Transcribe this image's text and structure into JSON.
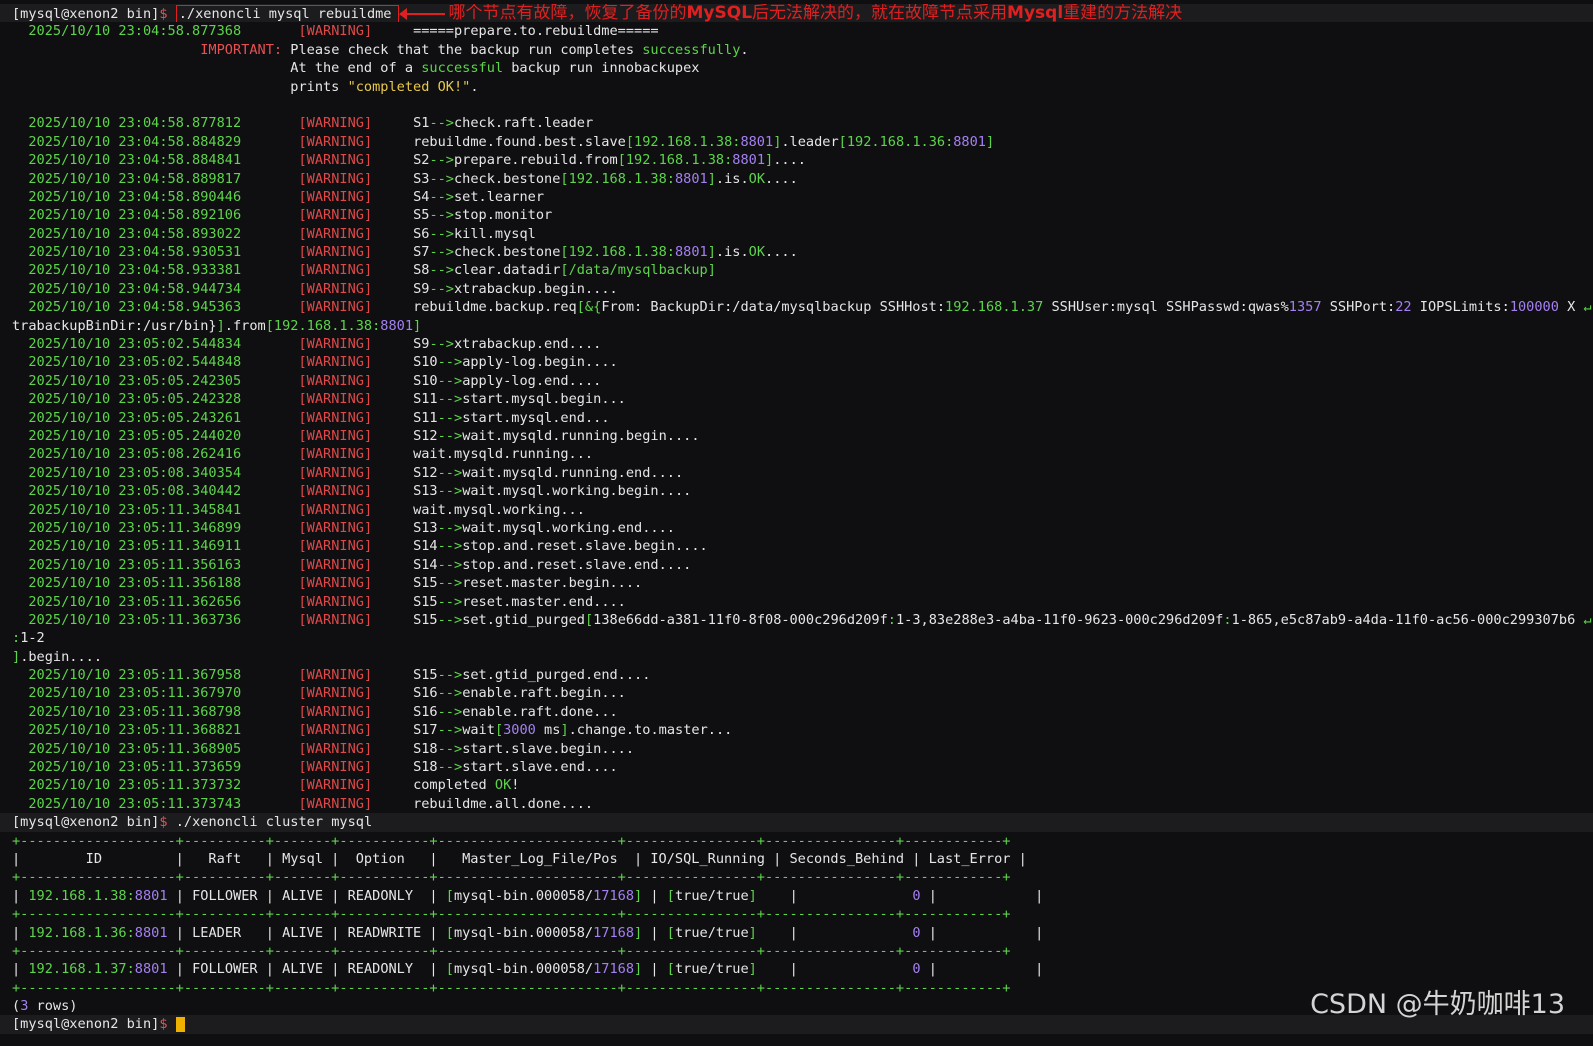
{
  "prompt": "[mysql@xenon2 bin]",
  "dollar": "$",
  "cmd1": "./xenoncli mysql rebuildme",
  "annotation": {
    "p1": "哪个节点有故障，恢复了备份的",
    "b1": "MySQL",
    "p2": "后无法解决的，就在故障节点采用",
    "b2": "Mysql",
    "p3": "重建的方法解决"
  },
  "warn_label": "[WARNING]",
  "prepare_ts": "2025/10/10 23:04:58.877368",
  "prepare_msg": "=====prepare.to.rebuildme=====",
  "important_label": "IMPORTANT:",
  "important_lines": [
    [
      "Please check that the backup run completes ",
      "successfully",
      "."
    ],
    [
      "At the end of a ",
      "successful",
      " backup run innobackupex"
    ],
    [
      "prints ",
      "\"completed OK!\"",
      "."
    ]
  ],
  "logs_a": [
    {
      "ts": "2025/10/10 23:04:58.877812",
      "p": [
        {
          "t": "S1"
        },
        {
          "t": "-->",
          "c": "sep"
        },
        {
          "t": "check.raft.leader"
        }
      ]
    },
    {
      "ts": "2025/10/10 23:04:58.884829",
      "p": [
        {
          "t": "rebuildme.found.best.slave"
        },
        {
          "t": "[192.168.1.38:",
          "c": "green"
        },
        {
          "t": "8801",
          "c": "purple"
        },
        {
          "t": "]",
          "c": "green"
        },
        {
          "t": ".leader"
        },
        {
          "t": "[192.168.1.36:",
          "c": "green"
        },
        {
          "t": "8801",
          "c": "purple"
        },
        {
          "t": "]",
          "c": "green"
        }
      ]
    },
    {
      "ts": "2025/10/10 23:04:58.884841",
      "p": [
        {
          "t": "S2"
        },
        {
          "t": "-->",
          "c": "sep"
        },
        {
          "t": "prepare.rebuild.from"
        },
        {
          "t": "[192.168.1.38:",
          "c": "green"
        },
        {
          "t": "8801",
          "c": "purple"
        },
        {
          "t": "]",
          "c": "green"
        },
        {
          "t": "...."
        }
      ]
    },
    {
      "ts": "2025/10/10 23:04:58.889817",
      "p": [
        {
          "t": "S3"
        },
        {
          "t": "-->",
          "c": "sep"
        },
        {
          "t": "check.bestone"
        },
        {
          "t": "[192.168.1.38:",
          "c": "green"
        },
        {
          "t": "8801",
          "c": "purple"
        },
        {
          "t": "]",
          "c": "green"
        },
        {
          "t": ".is."
        },
        {
          "t": "OK",
          "c": "green"
        },
        {
          "t": "...."
        }
      ]
    },
    {
      "ts": "2025/10/10 23:04:58.890446",
      "p": [
        {
          "t": "S4"
        },
        {
          "t": "-->",
          "c": "sep"
        },
        {
          "t": "set.learner"
        }
      ]
    },
    {
      "ts": "2025/10/10 23:04:58.892106",
      "p": [
        {
          "t": "S5"
        },
        {
          "t": "-->",
          "c": "sep"
        },
        {
          "t": "stop.monitor"
        }
      ]
    },
    {
      "ts": "2025/10/10 23:04:58.893022",
      "p": [
        {
          "t": "S6"
        },
        {
          "t": "-->",
          "c": "sep"
        },
        {
          "t": "kill.mysql"
        }
      ]
    },
    {
      "ts": "2025/10/10 23:04:58.930531",
      "p": [
        {
          "t": "S7"
        },
        {
          "t": "-->",
          "c": "sep"
        },
        {
          "t": "check.bestone"
        },
        {
          "t": "[192.168.1.38:",
          "c": "green"
        },
        {
          "t": "8801",
          "c": "purple"
        },
        {
          "t": "]",
          "c": "green"
        },
        {
          "t": ".is."
        },
        {
          "t": "OK",
          "c": "green"
        },
        {
          "t": "...."
        }
      ]
    },
    {
      "ts": "2025/10/10 23:04:58.933381",
      "p": [
        {
          "t": "S8"
        },
        {
          "t": "-->",
          "c": "sep"
        },
        {
          "t": "clear.datadir"
        },
        {
          "t": "[/data/mysqlbackup]",
          "c": "green"
        }
      ]
    },
    {
      "ts": "2025/10/10 23:04:58.944734",
      "p": [
        {
          "t": "S9"
        },
        {
          "t": "-->",
          "c": "sep"
        },
        {
          "t": "xtrabackup.begin...."
        }
      ]
    },
    {
      "ts": "2025/10/10 23:04:58.945363",
      "p": [
        {
          "t": "rebuildme.backup.req"
        },
        {
          "t": "[&{",
          "c": "green"
        },
        {
          "t": "From: BackupDir:/data/mysqlbackup SSHHost:"
        },
        {
          "t": "192.168.1.37",
          "c": "green"
        },
        {
          "t": " SSHUser:mysql SSHPasswd:qwas%"
        },
        {
          "t": "1357",
          "c": "purple"
        },
        {
          "t": " SSHPort:"
        },
        {
          "t": "22",
          "c": "purple"
        },
        {
          "t": " IOPSLimits:"
        },
        {
          "t": "100000",
          "c": "purple"
        },
        {
          "t": " X "
        },
        {
          "t": "↵",
          "c": "green"
        }
      ]
    }
  ],
  "wrap1": [
    {
      "t": "trabackupBinDir:/usr/bin}"
    },
    {
      "t": "]",
      "c": "green"
    },
    {
      "t": ".from"
    },
    {
      "t": "[192.168.1.38:",
      "c": "green"
    },
    {
      "t": "8801",
      "c": "purple"
    },
    {
      "t": "]",
      "c": "green"
    }
  ],
  "logs_b": [
    {
      "ts": "2025/10/10 23:05:02.544834",
      "p": [
        {
          "t": "S9"
        },
        {
          "t": "-->",
          "c": "sep"
        },
        {
          "t": "xtrabackup.end...."
        }
      ]
    },
    {
      "ts": "2025/10/10 23:05:02.544848",
      "p": [
        {
          "t": "S10"
        },
        {
          "t": "-->",
          "c": "sep"
        },
        {
          "t": "apply-log.begin...."
        }
      ]
    },
    {
      "ts": "2025/10/10 23:05:05.242305",
      "p": [
        {
          "t": "S10"
        },
        {
          "t": "-->",
          "c": "sep"
        },
        {
          "t": "apply-log.end...."
        }
      ]
    },
    {
      "ts": "2025/10/10 23:05:05.242328",
      "p": [
        {
          "t": "S11"
        },
        {
          "t": "-->",
          "c": "sep"
        },
        {
          "t": "start.mysql.begin..."
        }
      ]
    },
    {
      "ts": "2025/10/10 23:05:05.243261",
      "p": [
        {
          "t": "S11"
        },
        {
          "t": "-->",
          "c": "sep"
        },
        {
          "t": "start.mysql.end..."
        }
      ]
    },
    {
      "ts": "2025/10/10 23:05:05.244020",
      "p": [
        {
          "t": "S12"
        },
        {
          "t": "-->",
          "c": "sep"
        },
        {
          "t": "wait.mysqld.running.begin...."
        }
      ]
    },
    {
      "ts": "2025/10/10 23:05:08.262416",
      "p": [
        {
          "t": "wait.mysqld.running..."
        }
      ]
    },
    {
      "ts": "2025/10/10 23:05:08.340354",
      "p": [
        {
          "t": "S12"
        },
        {
          "t": "-->",
          "c": "sep"
        },
        {
          "t": "wait.mysqld.running.end...."
        }
      ]
    },
    {
      "ts": "2025/10/10 23:05:08.340442",
      "p": [
        {
          "t": "S13"
        },
        {
          "t": "-->",
          "c": "sep"
        },
        {
          "t": "wait.mysql.working.begin...."
        }
      ]
    },
    {
      "ts": "2025/10/10 23:05:11.345841",
      "p": [
        {
          "t": "wait.mysql.working..."
        }
      ]
    },
    {
      "ts": "2025/10/10 23:05:11.346899",
      "p": [
        {
          "t": "S13"
        },
        {
          "t": "-->",
          "c": "sep"
        },
        {
          "t": "wait.mysql.working.end...."
        }
      ]
    },
    {
      "ts": "2025/10/10 23:05:11.346911",
      "p": [
        {
          "t": "S14"
        },
        {
          "t": "-->",
          "c": "sep"
        },
        {
          "t": "stop.and.reset.slave.begin...."
        }
      ]
    },
    {
      "ts": "2025/10/10 23:05:11.356163",
      "p": [
        {
          "t": "S14"
        },
        {
          "t": "-->",
          "c": "sep"
        },
        {
          "t": "stop.and.reset.slave.end...."
        }
      ]
    },
    {
      "ts": "2025/10/10 23:05:11.356188",
      "p": [
        {
          "t": "S15"
        },
        {
          "t": "-->",
          "c": "sep"
        },
        {
          "t": "reset.master.begin...."
        }
      ]
    },
    {
      "ts": "2025/10/10 23:05:11.362656",
      "p": [
        {
          "t": "S15"
        },
        {
          "t": "-->",
          "c": "sep"
        },
        {
          "t": "reset.master.end...."
        }
      ]
    },
    {
      "ts": "2025/10/10 23:05:11.363736",
      "p": [
        {
          "t": "S15"
        },
        {
          "t": "-->",
          "c": "sep"
        },
        {
          "t": "set.gtid_purged"
        },
        {
          "t": "[",
          "c": "green"
        },
        {
          "t": "138e66dd-a381-11f0-8f08-000c296d209f"
        },
        {
          "t": ":",
          "c": "green"
        },
        {
          "t": "1-3,83e288e3-a4ba-11f0-9623-000c296d209f"
        },
        {
          "t": ":",
          "c": "green"
        },
        {
          "t": "1-865,e5c87ab9-a4da-11f0-ac56-000c299307b6 "
        },
        {
          "t": "↵",
          "c": "green"
        }
      ]
    }
  ],
  "wrap2": [
    {
      "t": ":",
      "c": "green"
    },
    {
      "t": "1-2"
    }
  ],
  "wrap3": [
    {
      "t": "]",
      "c": "green"
    },
    {
      "t": ".begin...."
    }
  ],
  "logs_c": [
    {
      "ts": "2025/10/10 23:05:11.367958",
      "p": [
        {
          "t": "S15"
        },
        {
          "t": "-->",
          "c": "sep"
        },
        {
          "t": "set.gtid_purged.end...."
        }
      ]
    },
    {
      "ts": "2025/10/10 23:05:11.367970",
      "p": [
        {
          "t": "S16"
        },
        {
          "t": "-->",
          "c": "sep"
        },
        {
          "t": "enable.raft.begin..."
        }
      ]
    },
    {
      "ts": "2025/10/10 23:05:11.368798",
      "p": [
        {
          "t": "S16"
        },
        {
          "t": "-->",
          "c": "sep"
        },
        {
          "t": "enable.raft.done..."
        }
      ]
    },
    {
      "ts": "2025/10/10 23:05:11.368821",
      "p": [
        {
          "t": "S17"
        },
        {
          "t": "-->",
          "c": "sep"
        },
        {
          "t": "wait"
        },
        {
          "t": "[",
          "c": "green"
        },
        {
          "t": "3000",
          "c": "purple"
        },
        {
          "t": " ms"
        },
        {
          "t": "]",
          "c": "green"
        },
        {
          "t": ".change.to.master..."
        }
      ]
    },
    {
      "ts": "2025/10/10 23:05:11.368905",
      "p": [
        {
          "t": "S18"
        },
        {
          "t": "-->",
          "c": "sep"
        },
        {
          "t": "start.slave.begin...."
        }
      ]
    },
    {
      "ts": "2025/10/10 23:05:11.373659",
      "p": [
        {
          "t": "S18"
        },
        {
          "t": "-->",
          "c": "sep"
        },
        {
          "t": "start.slave.end...."
        }
      ]
    },
    {
      "ts": "2025/10/10 23:05:11.373732",
      "p": [
        {
          "t": "completed "
        },
        {
          "t": "OK",
          "c": "green"
        },
        {
          "t": "!"
        }
      ]
    },
    {
      "ts": "2025/10/10 23:05:11.373743",
      "p": [
        {
          "t": "rebuildme.all.done...."
        }
      ]
    }
  ],
  "cmd2": "./xenoncli cluster mysql",
  "table_sep": "+-------------------+----------+-------+-----------+----------------------+----------------+----------------+------------+",
  "table_header": "|        ID         |   Raft   | Mysql |  Option   |   Master_Log_File/Pos  | IO/SQL_Running | Seconds_Behind | Last_Error |",
  "rows": [
    {
      "ip": "192.168.1.38:",
      "port": "8801",
      "raft": "FOLLOWER",
      "mysql": "ALIVE",
      "option": "READONLY ",
      "file": "mysql-bin.000058/",
      "pos": "17168",
      "io": "true/true",
      "sec": "0"
    },
    {
      "ip": "192.168.1.36:",
      "port": "8801",
      "raft": "LEADER  ",
      "mysql": "ALIVE",
      "option": "READWRITE",
      "file": "mysql-bin.000058/",
      "pos": "17168",
      "io": "true/true",
      "sec": "0"
    },
    {
      "ip": "192.168.1.37:",
      "port": "8801",
      "raft": "FOLLOWER",
      "mysql": "ALIVE",
      "option": "READONLY ",
      "file": "mysql-bin.000058/",
      "pos": "17168",
      "io": "true/true",
      "sec": "0"
    }
  ],
  "rows_count": "3",
  "rows_label": " rows)",
  "watermark": "CSDN @牛奶咖啡13"
}
